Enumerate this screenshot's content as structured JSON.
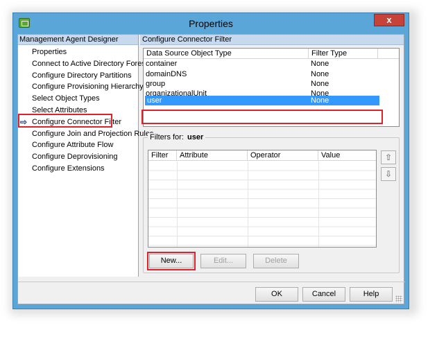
{
  "window": {
    "title": "Properties",
    "close_label": "x"
  },
  "left_pane": {
    "header": "Management Agent Designer",
    "items": [
      {
        "label": "Properties"
      },
      {
        "label": "Connect to Active Directory Forest"
      },
      {
        "label": "Configure Directory Partitions"
      },
      {
        "label": "Configure Provisioning Hierarchy"
      },
      {
        "label": "Select Object Types"
      },
      {
        "label": "Select Attributes"
      },
      {
        "label": "Configure Connector Filter"
      },
      {
        "label": "Configure Join and Projection Rules"
      },
      {
        "label": "Configure Attribute Flow"
      },
      {
        "label": "Configure Deprovisioning"
      },
      {
        "label": "Configure Extensions"
      }
    ],
    "selected_index": 6
  },
  "right_pane": {
    "header": "Configure Connector Filter",
    "object_list": {
      "columns": [
        "Data Source Object Type",
        "Filter Type"
      ],
      "rows": [
        {
          "type": "container",
          "filter": "None"
        },
        {
          "type": "domainDNS",
          "filter": "None"
        },
        {
          "type": "group",
          "filter": "None"
        },
        {
          "type": "organizationalUnit",
          "filter": "None"
        },
        {
          "type": "user",
          "filter": "None"
        }
      ],
      "selected_index": 4
    },
    "filters": {
      "label": "Filters for:",
      "object": "user",
      "columns": [
        "Filter",
        "Attribute",
        "Operator",
        "Value"
      ],
      "move_up_icon": "arrow-up-icon",
      "move_down_icon": "arrow-down-icon",
      "new_label": "New...",
      "edit_label": "Edit...",
      "delete_label": "Delete"
    }
  },
  "footer": {
    "ok_label": "OK",
    "cancel_label": "Cancel",
    "help_label": "Help"
  },
  "colors": {
    "title_bar": "#5aa6d8",
    "selection": "#3399ff",
    "highlight_outline": "#e0202a",
    "pane_header": "#c6d9ee"
  }
}
